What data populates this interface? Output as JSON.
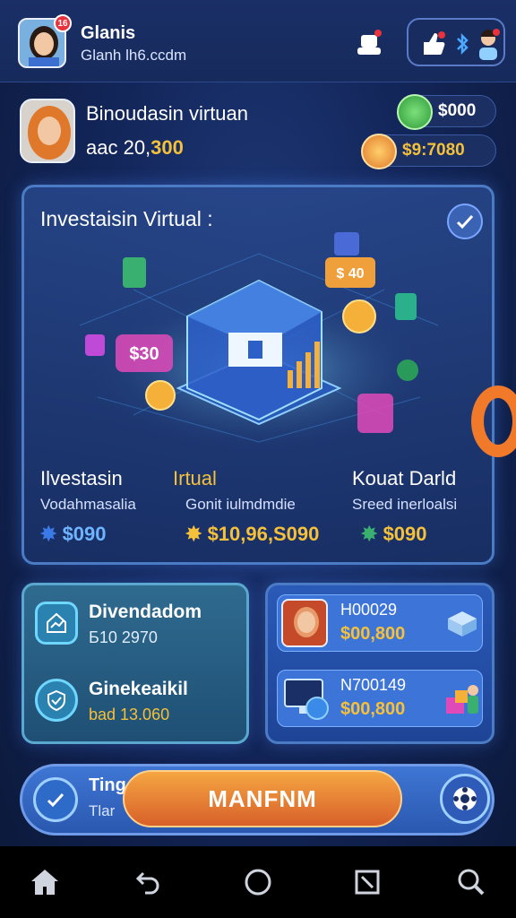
{
  "header": {
    "user_name": "Glanis",
    "user_email": "Glanh lh6.ccdm",
    "notification_count": "16"
  },
  "profile": {
    "name": "Binoudasin virtuan",
    "balance_prefix": "aac 20,",
    "balance_highlight": "300",
    "pill_1": "$000",
    "pill_2": "$9:7080"
  },
  "hero": {
    "title": "Investaisin Virtual :",
    "illustration_tags": {
      "card_top": "$ 40",
      "card_left": "$30"
    },
    "columns": [
      {
        "title": "Ilvestasin",
        "subtitle": "Vodahmasalia",
        "value": "$090"
      },
      {
        "title": "Irtual",
        "subtitle": "Gonit iulmdmdie",
        "value": "$10,96,S090"
      },
      {
        "title": "Kouat Darld",
        "subtitle": "Sreed inerloalsi",
        "value": "$090"
      }
    ]
  },
  "left_card": {
    "items": [
      {
        "title": "Divendadom",
        "value": "Б10 2970"
      },
      {
        "title": "Ginekeaikil",
        "value": "bad 13.060"
      }
    ]
  },
  "right_card": {
    "items": [
      {
        "code": "H00029",
        "value": "$00,800"
      },
      {
        "code": "N700149",
        "value": "$00,800"
      }
    ]
  },
  "action_bar": {
    "label_line1": "Ting",
    "label_line2": "Tlar",
    "main_button": "MANFNM"
  },
  "colors": {
    "accent_orange": "#f0a03a",
    "accent_yellow": "#f5c03a",
    "accent_blue": "#4aa8ff",
    "panel_border": "#4a7bc4"
  }
}
